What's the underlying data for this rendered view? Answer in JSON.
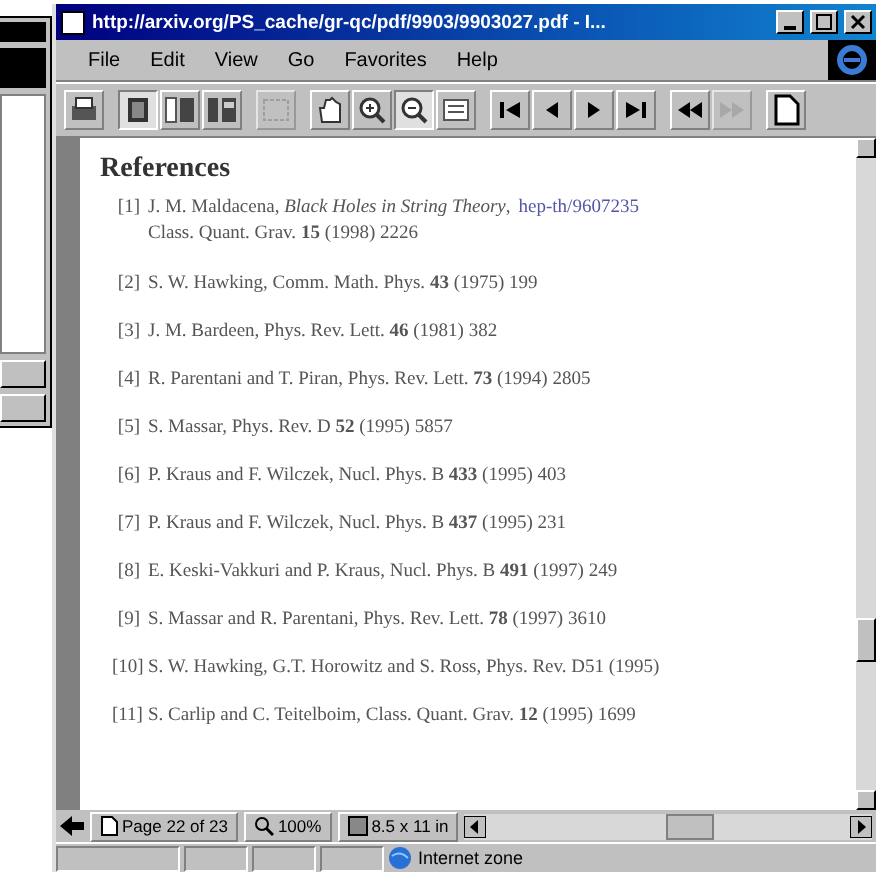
{
  "window": {
    "title": "http://arxiv.org/PS_cache/gr-qc/pdf/9903/9903027.pdf - I..."
  },
  "menu": [
    "File",
    "Edit",
    "View",
    "Go",
    "Favorites",
    "Help"
  ],
  "toolbar": [
    {
      "kind": "print",
      "pressed": false,
      "disabled": false
    },
    {
      "kind": "page",
      "pressed": true,
      "disabled": false
    },
    {
      "kind": "bookmarks",
      "pressed": false,
      "disabled": false
    },
    {
      "kind": "thumbnails",
      "pressed": false,
      "disabled": false
    },
    {
      "kind": "select",
      "pressed": false,
      "disabled": true
    },
    {
      "kind": "hand",
      "pressed": false,
      "disabled": false
    },
    {
      "kind": "zoomin",
      "pressed": false,
      "disabled": false
    },
    {
      "kind": "zoomout",
      "pressed": true,
      "disabled": false
    },
    {
      "kind": "text",
      "pressed": false,
      "disabled": false
    },
    {
      "kind": "first",
      "pressed": false,
      "disabled": false
    },
    {
      "kind": "prev",
      "pressed": false,
      "disabled": false
    },
    {
      "kind": "next",
      "pressed": false,
      "disabled": false
    },
    {
      "kind": "last",
      "pressed": false,
      "disabled": false
    },
    {
      "kind": "back",
      "pressed": false,
      "disabled": false
    },
    {
      "kind": "forward",
      "pressed": false,
      "disabled": true
    },
    {
      "kind": "document",
      "pressed": false,
      "disabled": false
    }
  ],
  "document": {
    "heading": "References",
    "references": [
      {
        "number": "[1]",
        "text": "J. M. Maldacena, *Black Holes in String Theory*,",
        "link": "hep-th/9607235",
        "continuation": "Class. Quant. Grav. **15** (1998) 2226"
      },
      {
        "number": "[2]",
        "text": "S. W. Hawking, Comm. Math. Phys. **43** (1975) 199"
      },
      {
        "number": "[3]",
        "text": "J. M. Bardeen, Phys. Rev. Lett. **46** (1981) 382"
      },
      {
        "number": "[4]",
        "text": "R. Parentani and T. Piran, Phys. Rev. Lett. **73** (1994) 2805"
      },
      {
        "number": "[5]",
        "text": "S. Massar, Phys. Rev. D **52** (1995) 5857"
      },
      {
        "number": "[6]",
        "text": "P. Kraus and F. Wilczek, Nucl. Phys. B **433** (1995) 403"
      },
      {
        "number": "[7]",
        "text": "P. Kraus and F. Wilczek, Nucl. Phys. B **437** (1995) 231"
      },
      {
        "number": "[8]",
        "text": "E. Keski-Vakkuri and P. Kraus, Nucl. Phys. B **491** (1997) 249"
      },
      {
        "number": "[9]",
        "text": "S. Massar and R. Parentani, Phys. Rev. Lett. **78** (1997) 3610"
      },
      {
        "number": "[10]",
        "text": "S. W. Hawking, G.T. Horowitz and S. Ross, Phys. Rev. D51 (1995)"
      },
      {
        "number": "[11]",
        "text": "S. Carlip and C. Teitelboim, Class. Quant. Grav. **12** (1995) 1699"
      }
    ]
  },
  "viewer_status": {
    "page": "Page 22 of 23",
    "zoom": "100%",
    "size": "8.5 x 11 in"
  },
  "status_bar": {
    "zone": "Internet zone"
  }
}
